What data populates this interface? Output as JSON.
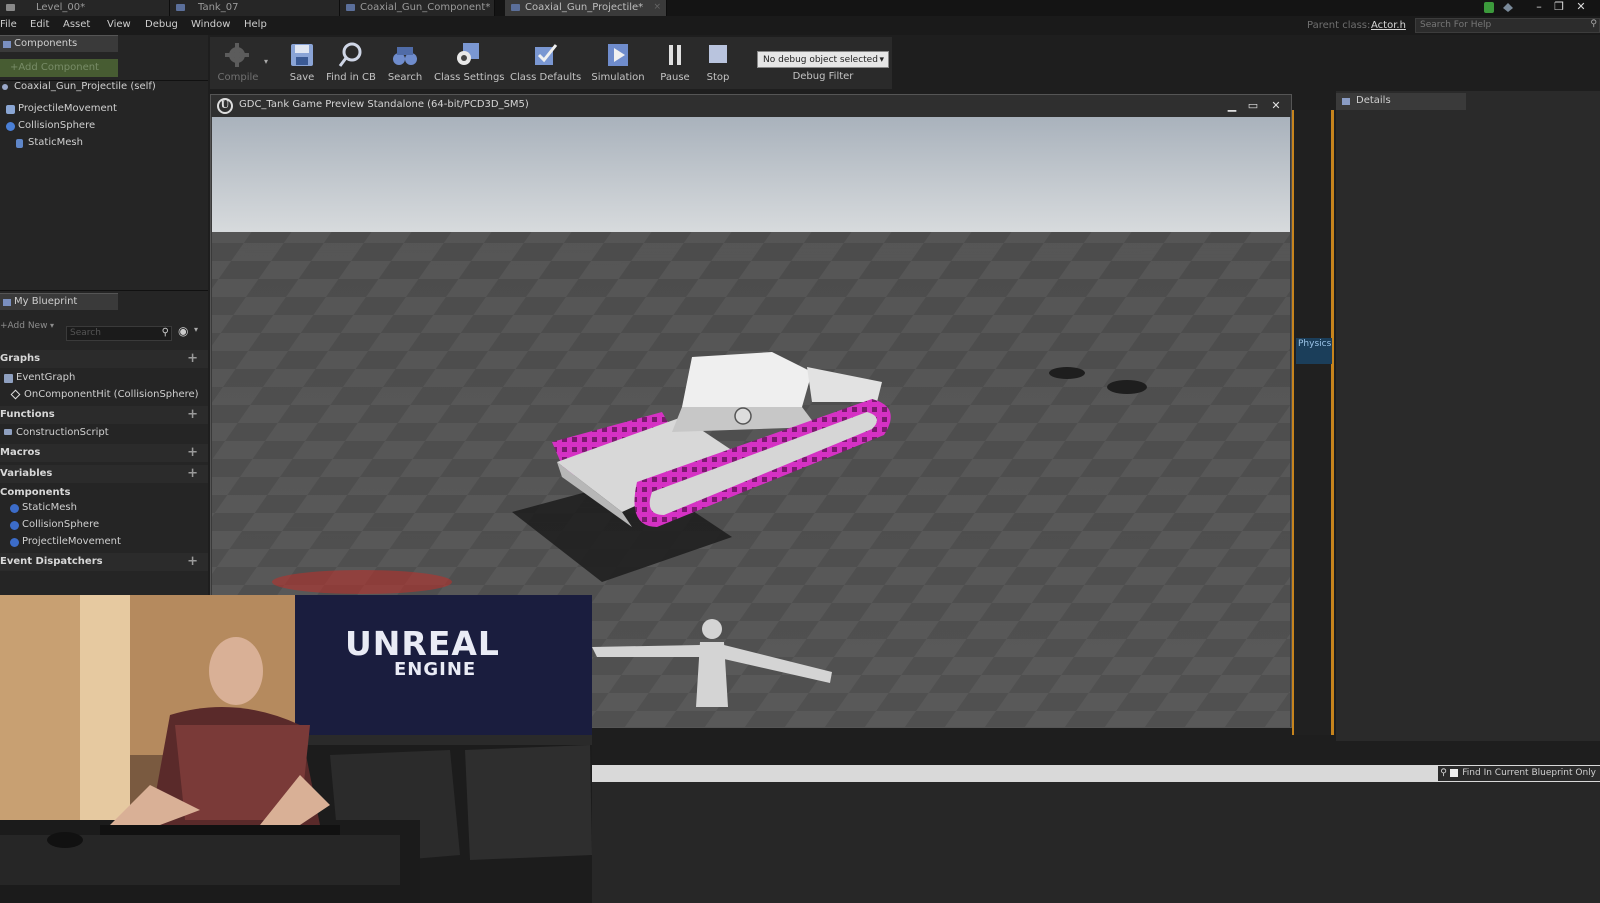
{
  "tabs": [
    {
      "label": "Level_00*"
    },
    {
      "label": "Tank_07"
    },
    {
      "label": "Coaxial_Gun_Component*"
    },
    {
      "label": "Coaxial_Gun_Projectile*"
    }
  ],
  "menu": [
    "File",
    "Edit",
    "Asset",
    "View",
    "Debug",
    "Window",
    "Help"
  ],
  "header": {
    "parent_class_label": "Parent class:",
    "parent_class_value": "Actor.h",
    "search_help_placeholder": "Search For Help"
  },
  "components_panel": {
    "tab_label": "Components",
    "add_component_label": "+Add Component",
    "root": "Coaxial_Gun_Projectile (self)",
    "items": [
      "ProjectileMovement",
      "CollisionSphere",
      "StaticMesh"
    ]
  },
  "my_blueprint": {
    "tab_label": "My Blueprint",
    "add_new_label": "+Add New",
    "search_placeholder": "Search",
    "sections": {
      "graphs": "Graphs",
      "graph_items": [
        "EventGraph",
        "OnComponentHit (CollisionSphere)"
      ],
      "functions": "Functions",
      "function_items": [
        "ConstructionScript"
      ],
      "macros": "Macros",
      "variables": "Variables",
      "components": "Components",
      "component_items": [
        "StaticMesh",
        "CollisionSphere",
        "ProjectileMovement"
      ],
      "event_dispatchers": "Event Dispatchers"
    }
  },
  "toolbar": {
    "compile": "Compile",
    "save": "Save",
    "find_in_cb": "Find in CB",
    "search": "Search",
    "class_settings": "Class Settings",
    "class_defaults": "Class Defaults",
    "simulation": "Simulation",
    "pause": "Pause",
    "stop": "Stop",
    "debug_object": "No debug object selected",
    "debug_filter": "Debug Filter"
  },
  "preview": {
    "title": "GDC_Tank Game Preview Standalone (64-bit/PCD3D_SM5)"
  },
  "details": {
    "tab_label": "Details"
  },
  "graph_strip_label": "Physics",
  "find_results": {
    "checkbox_label": "Find In Current Blueprint Only"
  },
  "webcam_brand": {
    "main": "UNREAL",
    "sub": "ENGINE"
  },
  "colors": {
    "accent_orange": "#c7841d",
    "tank_track": "#d531c4",
    "sky": "#c9d2da"
  }
}
